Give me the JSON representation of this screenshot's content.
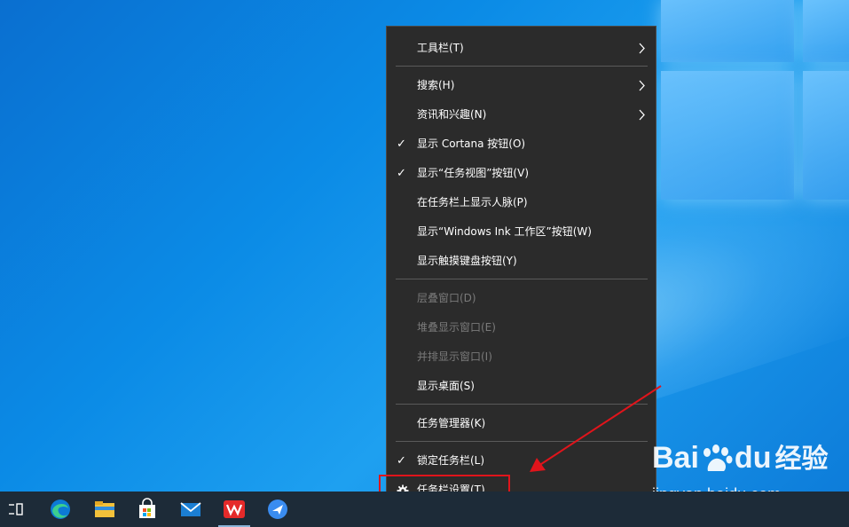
{
  "context_menu": {
    "items": [
      {
        "label": "工具栏(T)",
        "checked": false,
        "submenu": true,
        "disabled": false
      },
      {
        "label": "搜索(H)",
        "checked": false,
        "submenu": true,
        "disabled": false
      },
      {
        "label": "资讯和兴趣(N)",
        "checked": false,
        "submenu": true,
        "disabled": false
      },
      {
        "label": "显示 Cortana 按钮(O)",
        "checked": true,
        "submenu": false,
        "disabled": false
      },
      {
        "label": "显示“任务视图”按钮(V)",
        "checked": true,
        "submenu": false,
        "disabled": false
      },
      {
        "label": "在任务栏上显示人脉(P)",
        "checked": false,
        "submenu": false,
        "disabled": false
      },
      {
        "label": "显示“Windows Ink 工作区”按钮(W)",
        "checked": false,
        "submenu": false,
        "disabled": false
      },
      {
        "label": "显示触摸键盘按钮(Y)",
        "checked": false,
        "submenu": false,
        "disabled": false
      },
      {
        "label": "层叠窗口(D)",
        "checked": false,
        "submenu": false,
        "disabled": true
      },
      {
        "label": "堆叠显示窗口(E)",
        "checked": false,
        "submenu": false,
        "disabled": true
      },
      {
        "label": "并排显示窗口(I)",
        "checked": false,
        "submenu": false,
        "disabled": true
      },
      {
        "label": "显示桌面(S)",
        "checked": false,
        "submenu": false,
        "disabled": false
      },
      {
        "label": "任务管理器(K)",
        "checked": false,
        "submenu": false,
        "disabled": false
      },
      {
        "label": "锁定任务栏(L)",
        "checked": true,
        "submenu": false,
        "disabled": false
      },
      {
        "label": "任务栏设置(T)",
        "checked": false,
        "submenu": false,
        "disabled": false,
        "icon": "gear-icon"
      }
    ],
    "check_glyph": "✓"
  },
  "taskbar": {
    "icons": [
      "task-view-icon",
      "edge-icon",
      "file-explorer-icon",
      "store-icon",
      "mail-icon",
      "wps-icon",
      "feishu-icon"
    ]
  },
  "watermark": {
    "brand_prefix": "Bai",
    "brand_suffix": "du",
    "brand_cn": "经验",
    "url": "jingyan.baidu.com"
  },
  "colors": {
    "menu_bg": "#2b2b2b",
    "menu_text": "#ffffff",
    "menu_disabled": "#7a7a7a",
    "highlight": "#e0141b",
    "taskbar_bg": "#1d2b38"
  }
}
